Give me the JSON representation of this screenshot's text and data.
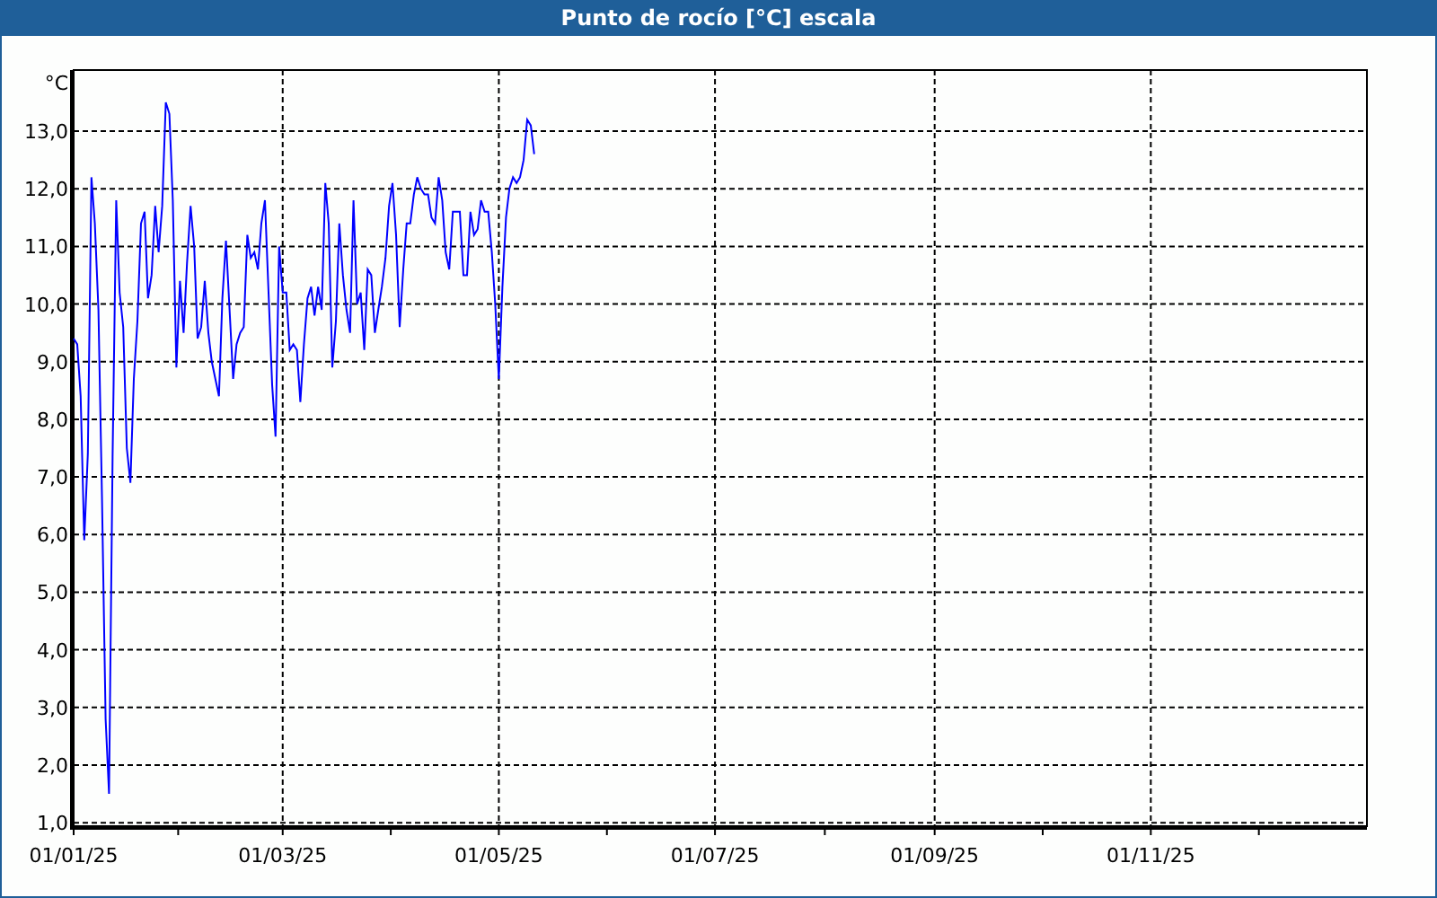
{
  "window": {
    "title": "Punto de rocío [°C] escala"
  },
  "chart_data": {
    "type": "line",
    "grid": true,
    "ylabel": "°C",
    "ylim": [
      0.94,
      14.06
    ],
    "yticks": [
      {
        "value": 1,
        "label": "1,0"
      },
      {
        "value": 2,
        "label": "2,0"
      },
      {
        "value": 3,
        "label": "3,0"
      },
      {
        "value": 4,
        "label": "4,0"
      },
      {
        "value": 5,
        "label": "5,0"
      },
      {
        "value": 6,
        "label": "6,0"
      },
      {
        "value": 7,
        "label": "7,0"
      },
      {
        "value": 8,
        "label": "8,0"
      },
      {
        "value": 9,
        "label": "9,0"
      },
      {
        "value": 10,
        "label": "10,0"
      },
      {
        "value": 11,
        "label": "11,0"
      },
      {
        "value": 12,
        "label": "12,0"
      },
      {
        "value": 13,
        "label": "13,0"
      }
    ],
    "categories": [
      "01/01/25",
      null,
      null,
      null,
      null,
      null,
      null,
      null,
      null,
      null,
      null,
      null,
      null,
      null,
      null,
      null,
      null,
      null,
      null,
      null,
      null,
      null,
      null,
      null,
      null,
      null,
      null,
      null,
      null,
      null,
      null,
      null,
      null,
      null,
      null,
      null,
      null,
      null,
      null,
      null,
      null,
      null,
      null,
      null,
      null,
      null,
      null,
      null,
      null,
      null,
      null,
      null,
      null,
      null,
      null,
      null,
      null,
      null,
      null,
      "01/03/25",
      null,
      null,
      null,
      null,
      null,
      null,
      null,
      null,
      null,
      null,
      null,
      null,
      null,
      null,
      null,
      null,
      null,
      null,
      null,
      null,
      null,
      null,
      null,
      null,
      null,
      null,
      null,
      null,
      null,
      null,
      null,
      null,
      null,
      null,
      null,
      null,
      null,
      null,
      null,
      null,
      null,
      null,
      null,
      null,
      null,
      null,
      null,
      null,
      null,
      null,
      null,
      null,
      null,
      null,
      null,
      null,
      null,
      null,
      null,
      null,
      "01/05/25",
      null,
      null,
      null,
      null,
      null,
      null,
      null,
      null,
      null,
      null,
      null,
      null,
      null,
      null,
      null,
      null,
      null,
      null,
      null,
      null,
      null,
      null,
      null,
      null,
      null,
      null,
      null,
      null,
      null,
      null,
      null,
      null,
      null,
      null,
      null,
      null,
      null,
      null,
      null,
      null,
      null,
      null,
      null,
      null,
      null,
      null,
      null,
      null,
      null,
      null,
      null,
      null,
      null,
      null,
      null,
      null,
      null,
      null,
      null,
      null,
      "01/07/25",
      null,
      null,
      null,
      null,
      null,
      null,
      null,
      null,
      null,
      null,
      null,
      null,
      null,
      null,
      null,
      null,
      null,
      null,
      null,
      null,
      null,
      null,
      null,
      null,
      null,
      null,
      null,
      null,
      null,
      null,
      null,
      null,
      null,
      null,
      null,
      null,
      null,
      null,
      null,
      null,
      null,
      null,
      null,
      null,
      null,
      null,
      null,
      null,
      null,
      null,
      null,
      null,
      null,
      null,
      null,
      null,
      null,
      null,
      null,
      null,
      null,
      "01/09/25",
      null,
      null,
      null,
      null,
      null,
      null,
      null,
      null,
      null,
      null,
      null,
      null,
      null,
      null,
      null,
      null,
      null,
      null,
      null,
      null,
      null,
      null,
      null,
      null,
      null,
      null,
      null,
      null,
      null,
      null,
      null,
      null,
      null,
      null,
      null,
      null,
      null,
      null,
      null,
      null,
      null,
      null,
      null,
      null,
      null,
      null,
      null,
      null,
      null,
      null,
      null,
      null,
      null,
      null,
      null,
      null,
      null,
      null,
      null,
      null,
      "01/11/25",
      null,
      null,
      null,
      null,
      null,
      null,
      null,
      null,
      null,
      null,
      null,
      null,
      null,
      null,
      null,
      null,
      null,
      null,
      null,
      null,
      null,
      null,
      null,
      null,
      null,
      null,
      null,
      null,
      null,
      null,
      null,
      null,
      null,
      null,
      null,
      null,
      null,
      null,
      null,
      null,
      null,
      null,
      null,
      null,
      null,
      null,
      null,
      null,
      null,
      null,
      null,
      null,
      null,
      null,
      null,
      null,
      null,
      null,
      null,
      null,
      null
    ],
    "series": [
      {
        "color": "#0000ff",
        "values": [
          9.4,
          9.3,
          8.4,
          5.9,
          7.4,
          12.2,
          11.4,
          9.9,
          6.6,
          2.8,
          1.5,
          7.4,
          11.8,
          10.2,
          9.6,
          7.5,
          6.9,
          8.7,
          9.7,
          11.4,
          11.6,
          10.1,
          10.5,
          11.7,
          10.9,
          11.7,
          13.5,
          13.3,
          11.8,
          8.9,
          10.4,
          9.5,
          10.7,
          11.7,
          11.0,
          9.4,
          9.6,
          10.4,
          9.5,
          9.0,
          8.7,
          8.4,
          10.1,
          11.1,
          9.9,
          8.7,
          9.3,
          9.5,
          9.6,
          11.2,
          10.8,
          10.9,
          10.6,
          11.4,
          11.8,
          10.2,
          8.6,
          7.7,
          11.0,
          10.2,
          10.2,
          9.2,
          9.3,
          9.2,
          8.3,
          9.3,
          10.1,
          10.3,
          9.8,
          10.3,
          9.9,
          12.1,
          11.4,
          8.9,
          9.7,
          11.4,
          10.5,
          9.9,
          9.5,
          11.8,
          10.0,
          10.2,
          9.2,
          10.6,
          10.5,
          9.5,
          9.9,
          10.3,
          10.8,
          11.7,
          12.1,
          11.2,
          9.6,
          10.6,
          11.4,
          11.4,
          11.9,
          12.2,
          12.0,
          11.9,
          11.9,
          11.5,
          11.4,
          12.2,
          11.8,
          10.9,
          10.6,
          11.6,
          11.6,
          11.6,
          10.5,
          10.5,
          11.6,
          11.2,
          11.3,
          11.8,
          11.6,
          11.6,
          10.9,
          10.0,
          8.7,
          10.3,
          11.5,
          12.0,
          12.2,
          12.1,
          12.2,
          12.5,
          13.2,
          13.1,
          12.6,
          null,
          null,
          null,
          null,
          null,
          null,
          null,
          null,
          null,
          null,
          null,
          null,
          null,
          null,
          null,
          null,
          null,
          null,
          null,
          null,
          null,
          null,
          null,
          null,
          null,
          null,
          null,
          null,
          null,
          null,
          null,
          null,
          null,
          null,
          null,
          null,
          null,
          null,
          null,
          null,
          null,
          null,
          null,
          null,
          null,
          null,
          null,
          null,
          null,
          null,
          null,
          null,
          null,
          null,
          null,
          null,
          null,
          null,
          null,
          null,
          null,
          null,
          null,
          null,
          null,
          null,
          null,
          null,
          null,
          null,
          null,
          null,
          null,
          null,
          null,
          null,
          null,
          null,
          null,
          null,
          null,
          null,
          null,
          null,
          null,
          null,
          null,
          null,
          null,
          null,
          null,
          null,
          null,
          null,
          null,
          null,
          null,
          null,
          null,
          null,
          null,
          null,
          null,
          null,
          null,
          null,
          null,
          null,
          null,
          null,
          null,
          null,
          null,
          null,
          null,
          null,
          null,
          null,
          null,
          null,
          null,
          null,
          null,
          null,
          null,
          null,
          null,
          null,
          null,
          null,
          null,
          null,
          null,
          null,
          null,
          null,
          null,
          null,
          null,
          null,
          null,
          null,
          null,
          null,
          null,
          null,
          null,
          null,
          null,
          null,
          null,
          null,
          null,
          null,
          null,
          null,
          null,
          null,
          null,
          null,
          null,
          null,
          null,
          null,
          null,
          null,
          null,
          null,
          null,
          null,
          null,
          null,
          null,
          null,
          null,
          null,
          null,
          null,
          null,
          null,
          null,
          null,
          null,
          null,
          null,
          null,
          null,
          null,
          null,
          null,
          null,
          null,
          null,
          null,
          null,
          null,
          null,
          null,
          null,
          null,
          null,
          null,
          null,
          null,
          null,
          null,
          null,
          null,
          null,
          null,
          null,
          null,
          null,
          null,
          null,
          null,
          null,
          null,
          null,
          null,
          null,
          null,
          null,
          null,
          null,
          null,
          null,
          null,
          null,
          null,
          null,
          null,
          null,
          null,
          null
        ]
      }
    ]
  }
}
